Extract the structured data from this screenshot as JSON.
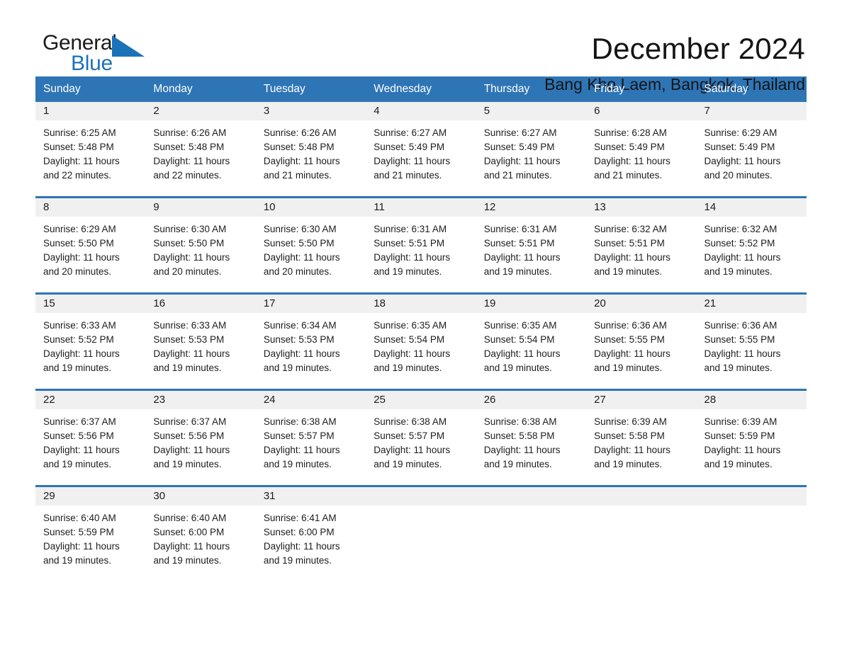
{
  "logo": {
    "word_primary": "General",
    "word_secondary": "Blue",
    "triangle_color": "#1c72b8",
    "primary_color": "#1b1b1b"
  },
  "header": {
    "month_title": "December 2024",
    "location": "Bang Kho Laem, Bangkok, Thailand"
  },
  "theme": {
    "header_blue": "#2e75b6",
    "row_divider_blue": "#2e75b6",
    "day_strip_gray": "#f0f0f0",
    "text_color": "#1d1d1d"
  },
  "weekdays": [
    "Sunday",
    "Monday",
    "Tuesday",
    "Wednesday",
    "Thursday",
    "Friday",
    "Saturday"
  ],
  "weeks": [
    [
      {
        "day": "1",
        "sunrise": "Sunrise: 6:25 AM",
        "sunset": "Sunset: 5:48 PM",
        "daylight_line1": "Daylight: 11 hours",
        "daylight_line2": "and 22 minutes."
      },
      {
        "day": "2",
        "sunrise": "Sunrise: 6:26 AM",
        "sunset": "Sunset: 5:48 PM",
        "daylight_line1": "Daylight: 11 hours",
        "daylight_line2": "and 22 minutes."
      },
      {
        "day": "3",
        "sunrise": "Sunrise: 6:26 AM",
        "sunset": "Sunset: 5:48 PM",
        "daylight_line1": "Daylight: 11 hours",
        "daylight_line2": "and 21 minutes."
      },
      {
        "day": "4",
        "sunrise": "Sunrise: 6:27 AM",
        "sunset": "Sunset: 5:49 PM",
        "daylight_line1": "Daylight: 11 hours",
        "daylight_line2": "and 21 minutes."
      },
      {
        "day": "5",
        "sunrise": "Sunrise: 6:27 AM",
        "sunset": "Sunset: 5:49 PM",
        "daylight_line1": "Daylight: 11 hours",
        "daylight_line2": "and 21 minutes."
      },
      {
        "day": "6",
        "sunrise": "Sunrise: 6:28 AM",
        "sunset": "Sunset: 5:49 PM",
        "daylight_line1": "Daylight: 11 hours",
        "daylight_line2": "and 21 minutes."
      },
      {
        "day": "7",
        "sunrise": "Sunrise: 6:29 AM",
        "sunset": "Sunset: 5:49 PM",
        "daylight_line1": "Daylight: 11 hours",
        "daylight_line2": "and 20 minutes."
      }
    ],
    [
      {
        "day": "8",
        "sunrise": "Sunrise: 6:29 AM",
        "sunset": "Sunset: 5:50 PM",
        "daylight_line1": "Daylight: 11 hours",
        "daylight_line2": "and 20 minutes."
      },
      {
        "day": "9",
        "sunrise": "Sunrise: 6:30 AM",
        "sunset": "Sunset: 5:50 PM",
        "daylight_line1": "Daylight: 11 hours",
        "daylight_line2": "and 20 minutes."
      },
      {
        "day": "10",
        "sunrise": "Sunrise: 6:30 AM",
        "sunset": "Sunset: 5:50 PM",
        "daylight_line1": "Daylight: 11 hours",
        "daylight_line2": "and 20 minutes."
      },
      {
        "day": "11",
        "sunrise": "Sunrise: 6:31 AM",
        "sunset": "Sunset: 5:51 PM",
        "daylight_line1": "Daylight: 11 hours",
        "daylight_line2": "and 19 minutes."
      },
      {
        "day": "12",
        "sunrise": "Sunrise: 6:31 AM",
        "sunset": "Sunset: 5:51 PM",
        "daylight_line1": "Daylight: 11 hours",
        "daylight_line2": "and 19 minutes."
      },
      {
        "day": "13",
        "sunrise": "Sunrise: 6:32 AM",
        "sunset": "Sunset: 5:51 PM",
        "daylight_line1": "Daylight: 11 hours",
        "daylight_line2": "and 19 minutes."
      },
      {
        "day": "14",
        "sunrise": "Sunrise: 6:32 AM",
        "sunset": "Sunset: 5:52 PM",
        "daylight_line1": "Daylight: 11 hours",
        "daylight_line2": "and 19 minutes."
      }
    ],
    [
      {
        "day": "15",
        "sunrise": "Sunrise: 6:33 AM",
        "sunset": "Sunset: 5:52 PM",
        "daylight_line1": "Daylight: 11 hours",
        "daylight_line2": "and 19 minutes."
      },
      {
        "day": "16",
        "sunrise": "Sunrise: 6:33 AM",
        "sunset": "Sunset: 5:53 PM",
        "daylight_line1": "Daylight: 11 hours",
        "daylight_line2": "and 19 minutes."
      },
      {
        "day": "17",
        "sunrise": "Sunrise: 6:34 AM",
        "sunset": "Sunset: 5:53 PM",
        "daylight_line1": "Daylight: 11 hours",
        "daylight_line2": "and 19 minutes."
      },
      {
        "day": "18",
        "sunrise": "Sunrise: 6:35 AM",
        "sunset": "Sunset: 5:54 PM",
        "daylight_line1": "Daylight: 11 hours",
        "daylight_line2": "and 19 minutes."
      },
      {
        "day": "19",
        "sunrise": "Sunrise: 6:35 AM",
        "sunset": "Sunset: 5:54 PM",
        "daylight_line1": "Daylight: 11 hours",
        "daylight_line2": "and 19 minutes."
      },
      {
        "day": "20",
        "sunrise": "Sunrise: 6:36 AM",
        "sunset": "Sunset: 5:55 PM",
        "daylight_line1": "Daylight: 11 hours",
        "daylight_line2": "and 19 minutes."
      },
      {
        "day": "21",
        "sunrise": "Sunrise: 6:36 AM",
        "sunset": "Sunset: 5:55 PM",
        "daylight_line1": "Daylight: 11 hours",
        "daylight_line2": "and 19 minutes."
      }
    ],
    [
      {
        "day": "22",
        "sunrise": "Sunrise: 6:37 AM",
        "sunset": "Sunset: 5:56 PM",
        "daylight_line1": "Daylight: 11 hours",
        "daylight_line2": "and 19 minutes."
      },
      {
        "day": "23",
        "sunrise": "Sunrise: 6:37 AM",
        "sunset": "Sunset: 5:56 PM",
        "daylight_line1": "Daylight: 11 hours",
        "daylight_line2": "and 19 minutes."
      },
      {
        "day": "24",
        "sunrise": "Sunrise: 6:38 AM",
        "sunset": "Sunset: 5:57 PM",
        "daylight_line1": "Daylight: 11 hours",
        "daylight_line2": "and 19 minutes."
      },
      {
        "day": "25",
        "sunrise": "Sunrise: 6:38 AM",
        "sunset": "Sunset: 5:57 PM",
        "daylight_line1": "Daylight: 11 hours",
        "daylight_line2": "and 19 minutes."
      },
      {
        "day": "26",
        "sunrise": "Sunrise: 6:38 AM",
        "sunset": "Sunset: 5:58 PM",
        "daylight_line1": "Daylight: 11 hours",
        "daylight_line2": "and 19 minutes."
      },
      {
        "day": "27",
        "sunrise": "Sunrise: 6:39 AM",
        "sunset": "Sunset: 5:58 PM",
        "daylight_line1": "Daylight: 11 hours",
        "daylight_line2": "and 19 minutes."
      },
      {
        "day": "28",
        "sunrise": "Sunrise: 6:39 AM",
        "sunset": "Sunset: 5:59 PM",
        "daylight_line1": "Daylight: 11 hours",
        "daylight_line2": "and 19 minutes."
      }
    ],
    [
      {
        "day": "29",
        "sunrise": "Sunrise: 6:40 AM",
        "sunset": "Sunset: 5:59 PM",
        "daylight_line1": "Daylight: 11 hours",
        "daylight_line2": "and 19 minutes."
      },
      {
        "day": "30",
        "sunrise": "Sunrise: 6:40 AM",
        "sunset": "Sunset: 6:00 PM",
        "daylight_line1": "Daylight: 11 hours",
        "daylight_line2": "and 19 minutes."
      },
      {
        "day": "31",
        "sunrise": "Sunrise: 6:41 AM",
        "sunset": "Sunset: 6:00 PM",
        "daylight_line1": "Daylight: 11 hours",
        "daylight_line2": "and 19 minutes."
      },
      {
        "day": "",
        "sunrise": "",
        "sunset": "",
        "daylight_line1": "",
        "daylight_line2": ""
      },
      {
        "day": "",
        "sunrise": "",
        "sunset": "",
        "daylight_line1": "",
        "daylight_line2": ""
      },
      {
        "day": "",
        "sunrise": "",
        "sunset": "",
        "daylight_line1": "",
        "daylight_line2": ""
      },
      {
        "day": "",
        "sunrise": "",
        "sunset": "",
        "daylight_line1": "",
        "daylight_line2": ""
      }
    ]
  ]
}
